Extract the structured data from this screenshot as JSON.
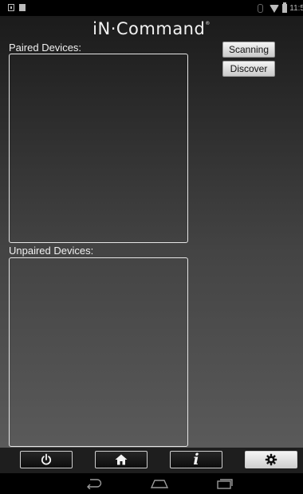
{
  "status_bar": {
    "time": "11:5",
    "icons": [
      "notification-icon",
      "notification-square-icon",
      "bluetooth-icon",
      "wifi-icon",
      "battery-icon"
    ]
  },
  "app": {
    "logo_text": "iN·Command",
    "logo_mark": "®",
    "paired_label": "Paired Devices:",
    "unpaired_label": "Unpaired Devices:",
    "scanning_button": "Scanning",
    "discover_button": "Discover"
  },
  "tab_bar": {
    "tabs": [
      {
        "name": "power",
        "icon": "power-icon",
        "active": false
      },
      {
        "name": "home",
        "icon": "home-icon",
        "active": false
      },
      {
        "name": "info",
        "icon": "info-icon",
        "glyph": "i",
        "active": false
      },
      {
        "name": "settings",
        "icon": "gear-icon",
        "active": true
      }
    ]
  },
  "nav_bar": {
    "buttons": [
      "back-icon",
      "home-nav-icon",
      "recents-icon"
    ]
  },
  "colors": {
    "active_tab_background": "#e6e6e6",
    "inactive_tab_background": "#111111",
    "text": "#f0f0f0"
  }
}
